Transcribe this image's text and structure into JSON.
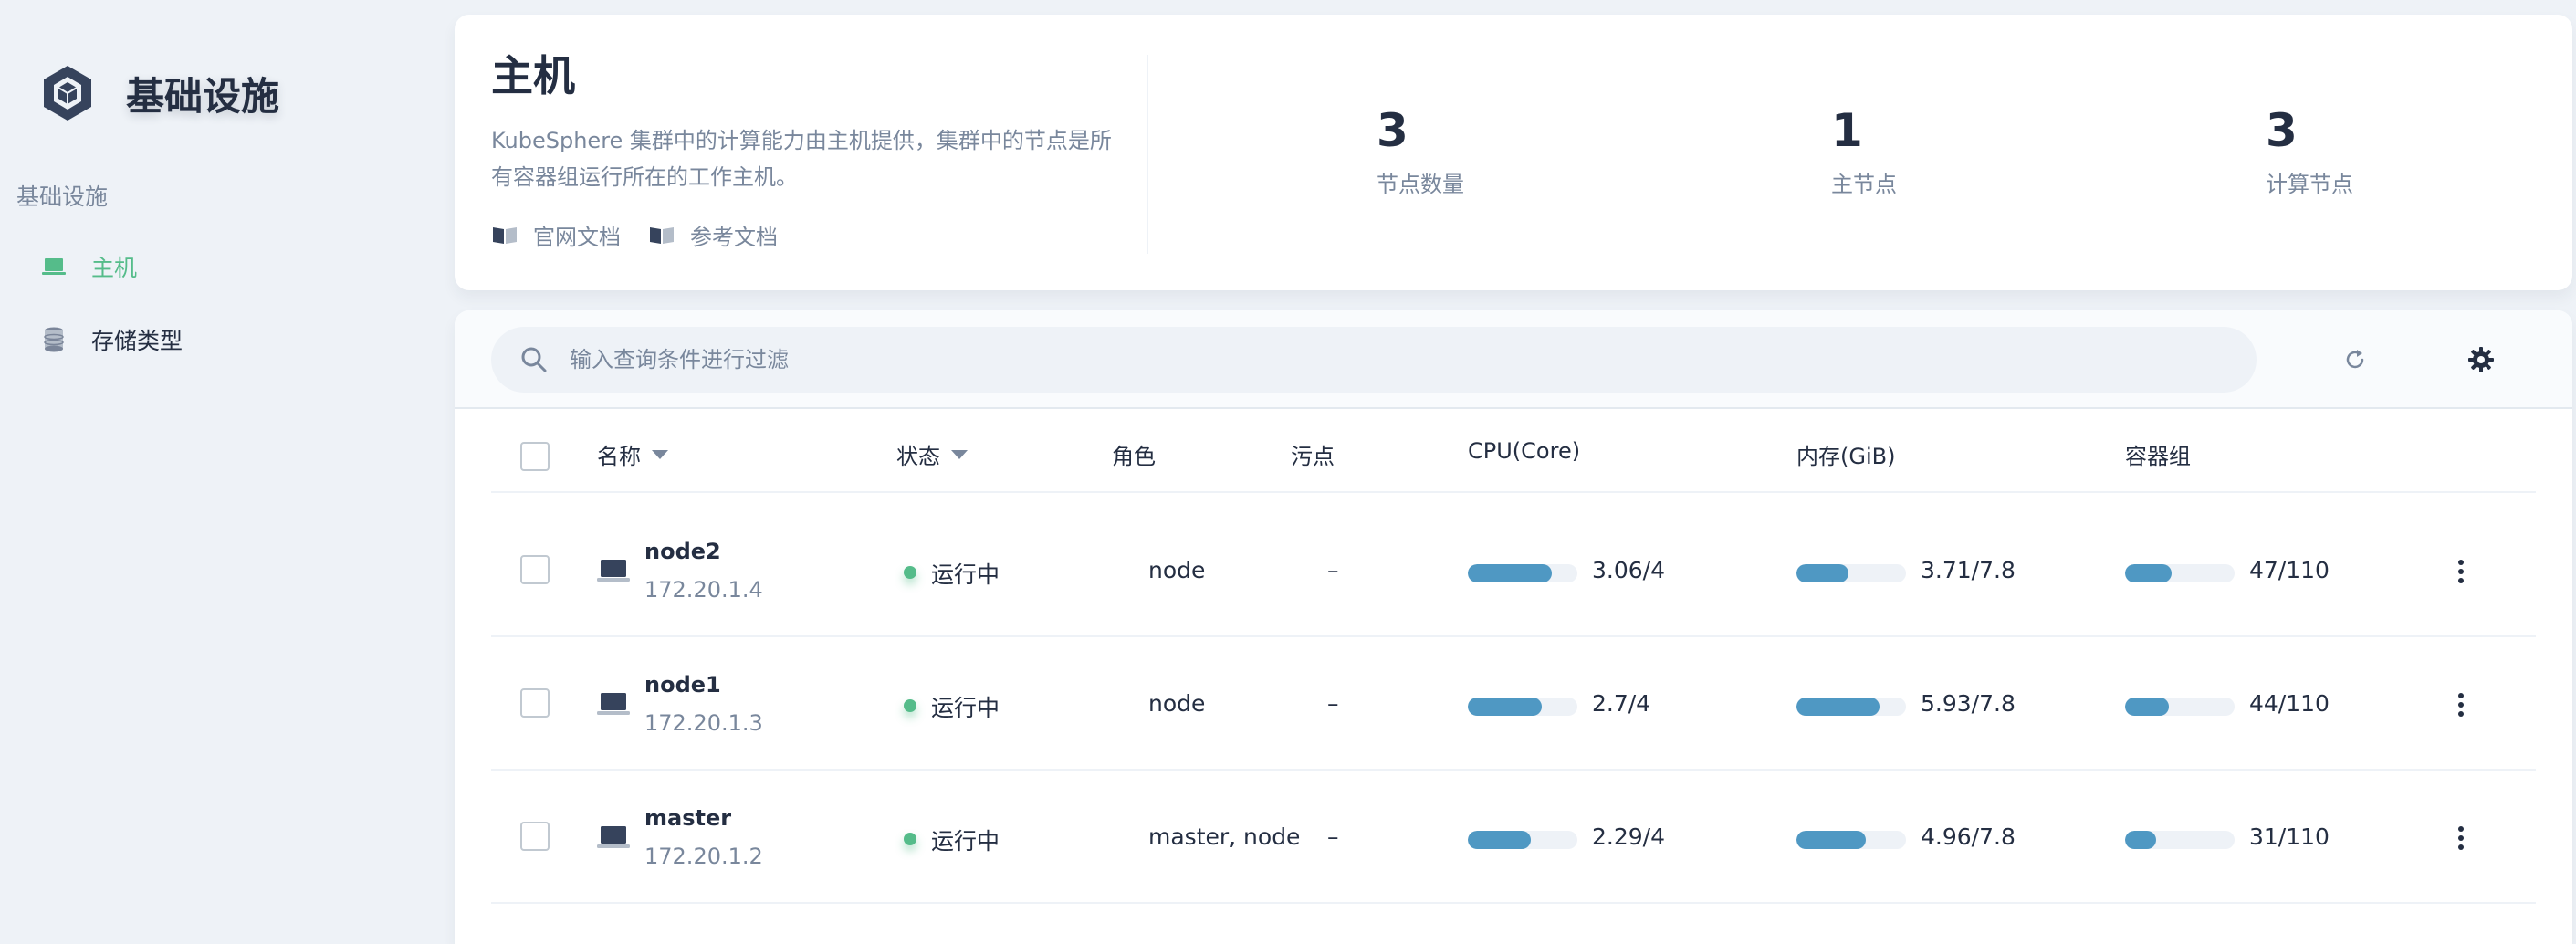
{
  "sidebar": {
    "title": "基础设施",
    "group_title": "基础设施",
    "items": [
      {
        "label": "主机",
        "icon": "laptop-icon",
        "active": true
      },
      {
        "label": "存储类型",
        "icon": "database-icon",
        "active": false
      }
    ]
  },
  "header": {
    "title": "主机",
    "description": "KubeSphere 集群中的计算能力由主机提供，集群中的节点是所有容器组运行所在的工作主机。",
    "links": [
      {
        "label": "官网文档",
        "icon": "book-icon"
      },
      {
        "label": "参考文档",
        "icon": "book-icon"
      }
    ],
    "stats": [
      {
        "value": "3",
        "label": "节点数量"
      },
      {
        "value": "1",
        "label": "主节点"
      },
      {
        "value": "3",
        "label": "计算节点"
      }
    ]
  },
  "toolbar": {
    "search_placeholder": "输入查询条件进行过滤",
    "refresh_icon": "refresh-icon",
    "settings_icon": "gear-icon"
  },
  "table": {
    "columns": {
      "name": "名称",
      "status": "状态",
      "role": "角色",
      "taint": "污点",
      "cpu": "CPU(Core)",
      "memory": "内存(GiB)",
      "pods": "容器组"
    },
    "rows": [
      {
        "name": "node2",
        "ip": "172.20.1.4",
        "status": "运行中",
        "role": "node",
        "taint": "–",
        "cpu": "3.06/4",
        "cpu_ratio": 0.765,
        "memory": "3.71/7.8",
        "memory_ratio": 0.476,
        "pods": "47/110",
        "pods_ratio": 0.427
      },
      {
        "name": "node1",
        "ip": "172.20.1.3",
        "status": "运行中",
        "role": "node",
        "taint": "–",
        "cpu": "2.7/4",
        "cpu_ratio": 0.675,
        "memory": "5.93/7.8",
        "memory_ratio": 0.76,
        "pods": "44/110",
        "pods_ratio": 0.4
      },
      {
        "name": "master",
        "ip": "172.20.1.2",
        "status": "运行中",
        "role": "master, node",
        "taint": "–",
        "cpu": "2.29/4",
        "cpu_ratio": 0.5725,
        "memory": "4.96/7.8",
        "memory_ratio": 0.636,
        "pods": "31/110",
        "pods_ratio": 0.282
      }
    ]
  },
  "colors": {
    "accent": "#55bc8a",
    "bar_fill": "#3d8ebd",
    "text_primary": "#242e42",
    "text_secondary": "#79879c"
  }
}
